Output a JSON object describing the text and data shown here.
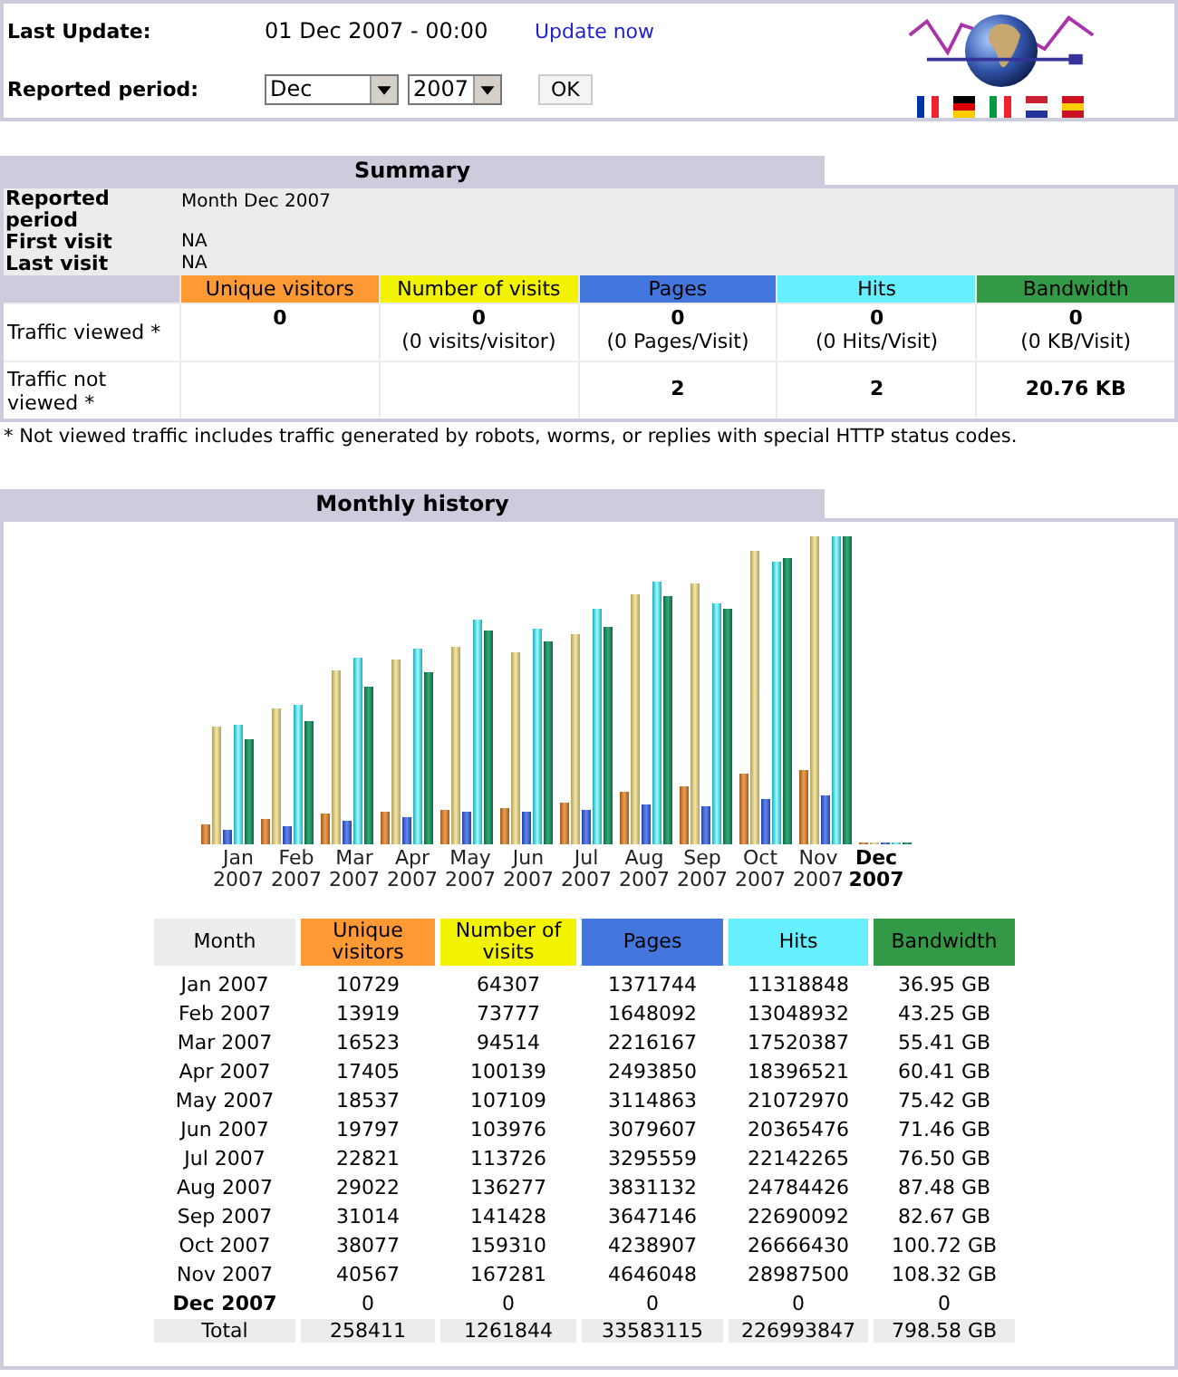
{
  "header": {
    "last_update_label": "Last Update:",
    "last_update": "01 Dec 2007 - 00:00",
    "update_link": "Update now",
    "period_label": "Reported period:",
    "month_select": "Dec",
    "year_select": "2007",
    "ok_button": "OK"
  },
  "flags": [
    {
      "kind": "fr"
    },
    {
      "kind": "de"
    },
    {
      "kind": "it"
    },
    {
      "kind": "nl"
    },
    {
      "kind": "es"
    }
  ],
  "summary": {
    "title": "Summary",
    "info": [
      {
        "label": "Reported period",
        "value": "Month Dec 2007"
      },
      {
        "label": "First visit",
        "value": "NA"
      },
      {
        "label": "Last visit",
        "value": "NA"
      }
    ],
    "columns": [
      {
        "label": "Unique visitors",
        "color": "#ff9933"
      },
      {
        "label": "Number of visits",
        "color": "#f3f300"
      },
      {
        "label": "Pages",
        "color": "#4477dd"
      },
      {
        "label": "Hits",
        "color": "#66f0ff"
      },
      {
        "label": "Bandwidth",
        "color": "#339944"
      }
    ],
    "rows": [
      {
        "label": "Traffic viewed *",
        "cells": [
          {
            "value": "0"
          },
          {
            "value": "0",
            "note": "(0 visits/visitor)"
          },
          {
            "value": "0",
            "note": "(0 Pages/Visit)"
          },
          {
            "value": "0",
            "note": "(0 Hits/Visit)"
          },
          {
            "value": "0",
            "note": "(0 KB/Visit)"
          }
        ]
      },
      {
        "label": "Traffic not viewed *",
        "cells": [
          {},
          {},
          {
            "value": "2"
          },
          {
            "value": "2"
          },
          {
            "value": "20.76 KB"
          }
        ]
      }
    ],
    "footnote": "* Not viewed traffic includes traffic generated by robots, worms, or replies with special HTTP status codes."
  },
  "monthly": {
    "title": "Monthly history",
    "chart_labels": [
      {
        "month": "Jan",
        "year": "2007",
        "current": false
      },
      {
        "month": "Feb",
        "year": "2007",
        "current": false
      },
      {
        "month": "Mar",
        "year": "2007",
        "current": false
      },
      {
        "month": "Apr",
        "year": "2007",
        "current": false
      },
      {
        "month": "May",
        "year": "2007",
        "current": false
      },
      {
        "month": "Jun",
        "year": "2007",
        "current": false
      },
      {
        "month": "Jul",
        "year": "2007",
        "current": false
      },
      {
        "month": "Aug",
        "year": "2007",
        "current": false
      },
      {
        "month": "Sep",
        "year": "2007",
        "current": false
      },
      {
        "month": "Oct",
        "year": "2007",
        "current": false
      },
      {
        "month": "Nov",
        "year": "2007",
        "current": false
      },
      {
        "month": "Dec",
        "year": "2007",
        "current": true
      }
    ],
    "columns": [
      {
        "label": "Month",
        "color": "#ececec"
      },
      {
        "label": "Unique visitors",
        "color": "#ff9933"
      },
      {
        "label": "Number of visits",
        "color": "#f3f300"
      },
      {
        "label": "Pages",
        "color": "#4477dd"
      },
      {
        "label": "Hits",
        "color": "#66f0ff"
      },
      {
        "label": "Bandwidth",
        "color": "#339944"
      }
    ],
    "rows": [
      {
        "month": "Jan 2007",
        "current": false,
        "values": [
          "10729",
          "64307",
          "1371744",
          "11318848",
          "36.95 GB"
        ]
      },
      {
        "month": "Feb 2007",
        "current": false,
        "values": [
          "13919",
          "73777",
          "1648092",
          "13048932",
          "43.25 GB"
        ]
      },
      {
        "month": "Mar 2007",
        "current": false,
        "values": [
          "16523",
          "94514",
          "2216167",
          "17520387",
          "55.41 GB"
        ]
      },
      {
        "month": "Apr 2007",
        "current": false,
        "values": [
          "17405",
          "100139",
          "2493850",
          "18396521",
          "60.41 GB"
        ]
      },
      {
        "month": "May 2007",
        "current": false,
        "values": [
          "18537",
          "107109",
          "3114863",
          "21072970",
          "75.42 GB"
        ]
      },
      {
        "month": "Jun 2007",
        "current": false,
        "values": [
          "19797",
          "103976",
          "3079607",
          "20365476",
          "71.46 GB"
        ]
      },
      {
        "month": "Jul 2007",
        "current": false,
        "values": [
          "22821",
          "113726",
          "3295559",
          "22142265",
          "76.50 GB"
        ]
      },
      {
        "month": "Aug 2007",
        "current": false,
        "values": [
          "29022",
          "136277",
          "3831132",
          "24784426",
          "87.48 GB"
        ]
      },
      {
        "month": "Sep 2007",
        "current": false,
        "values": [
          "31014",
          "141428",
          "3647146",
          "22690092",
          "82.67 GB"
        ]
      },
      {
        "month": "Oct 2007",
        "current": false,
        "values": [
          "38077",
          "159310",
          "4238907",
          "26666430",
          "100.72 GB"
        ]
      },
      {
        "month": "Nov 2007",
        "current": false,
        "values": [
          "40567",
          "167281",
          "4646048",
          "28987500",
          "108.32 GB"
        ]
      },
      {
        "month": "Dec 2007",
        "current": true,
        "values": [
          "0",
          "0",
          "0",
          "0",
          "0"
        ]
      }
    ],
    "total": {
      "label": "Total",
      "values": [
        "258411",
        "1261844",
        "33583115",
        "226993847",
        "798.58 GB"
      ]
    }
  }
}
